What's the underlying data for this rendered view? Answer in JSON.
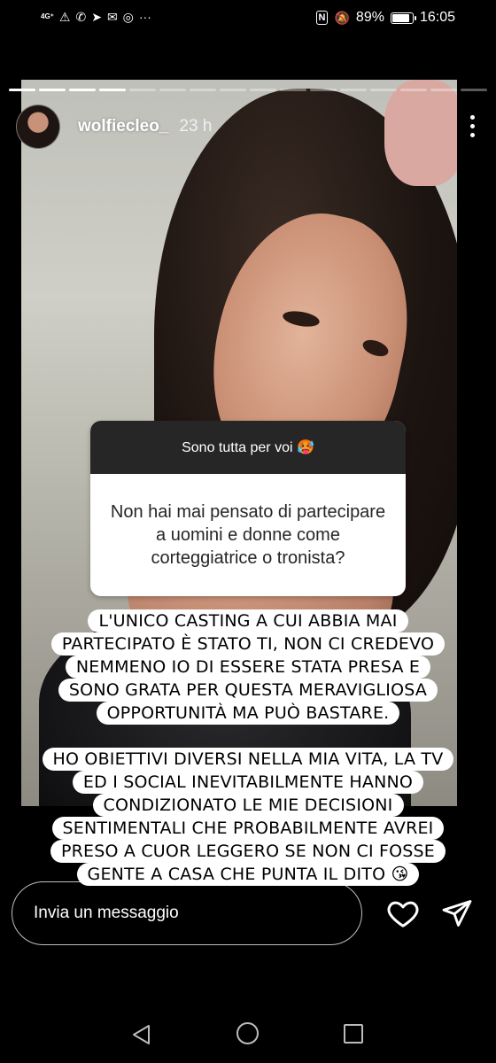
{
  "status_bar": {
    "network_label": "4G⁺",
    "notification_icons": [
      "⚠",
      "✆",
      "➤",
      "✉",
      "◎",
      "···"
    ],
    "nfc_glyph": "N",
    "mute_glyph": "🔕",
    "battery_percent": "89%",
    "battery_level": 0.89,
    "time": "16:05"
  },
  "story": {
    "progress": {
      "total_segments": 16,
      "completed": 4
    },
    "username": "wolfiecleo_",
    "time_ago": "23 h",
    "question": {
      "header": "Sono tutta per voi 🥵",
      "text": "Non hai mai pensato di partecipare a uomini e donne come corteggiatrice o tronista?"
    },
    "answer_1": [
      "L'UNICO CASTING A CUI ABBIA MAI",
      "PARTECIPATO È STATO TI, NON CI CREDEVO",
      "NEMMENO IO DI ESSERE STATA PRESA E",
      "SONO GRATA PER QUESTA MERAVIGLIOSA",
      "OPPORTUNITÀ MA PUÒ BASTARE."
    ],
    "answer_2": [
      "HO OBIETTIVI DIVERSI NELLA MIA VITA, LA TV",
      "ED I SOCIAL INEVITABILMENTE HANNO",
      "CONDIZIONATO LE MIE DECISIONI",
      "SENTIMENTALI CHE PROBABILMENTE AVREI",
      "PRESO A CUOR LEGGERO SE NON CI FOSSE",
      "GENTE A CASA CHE PUNTA IL DITO 😘"
    ]
  },
  "footer": {
    "message_placeholder": "Invia un messaggio",
    "like_icon": "heart-icon",
    "send_icon": "paper-plane-icon"
  },
  "colors": {
    "background": "#000000",
    "card_header": "#262626",
    "sticker": "#ffffff"
  }
}
